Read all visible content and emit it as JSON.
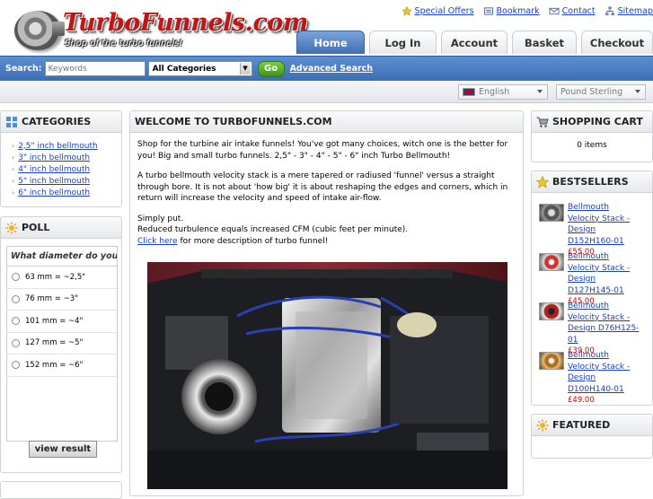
{
  "header": {
    "logo_text": "TurboFunnels.com",
    "tagline": "Shop of the turbo funnels!",
    "toplinks": [
      {
        "label": "Special Offers",
        "icon": "star-icon"
      },
      {
        "label": "Bookmark",
        "icon": "bookmark-icon"
      },
      {
        "label": "Contact",
        "icon": "envelope-icon"
      },
      {
        "label": "Sitemap",
        "icon": "sitemap-icon"
      }
    ],
    "tabs": [
      "Home",
      "Log In",
      "Account",
      "Basket",
      "Checkout"
    ]
  },
  "search": {
    "label": "Search:",
    "placeholder": "Keywords",
    "category": "All Categories",
    "go": "Go",
    "advanced": "Advanced Search"
  },
  "lang": {
    "language": "English",
    "currency": "Pound Sterling"
  },
  "categories": {
    "title": "CATEGORIES",
    "items": [
      "2,5\" inch bellmouth",
      "3\" inch bellmouth",
      "4\" inch bellmouth",
      "5\" inch bellmouth",
      "6\" inch bellmouth"
    ]
  },
  "poll": {
    "title": "POLL",
    "question": "What diameter do you need?",
    "options": [
      "63 mm = ~2,5\"",
      "76 mm = ~3\"",
      "101 mm = ~4\"",
      "127 mm = ~5\"",
      "152 mm = ~6\""
    ],
    "button": "view result"
  },
  "welcome": {
    "title": "WELCOME TO TURBOFUNNELS.COM",
    "p1": "Shop for the turbine air intake funnels! You've got many choices, witch one is the better for you! Big and small turbo funnels. 2,5\" - 3\" - 4\" - 5\" - 6\" inch Turbo Bellmouth!",
    "p2": "A turbo bellmouth velocity stack is a mere tapered or radiused 'funnel' versus a straight through bore. It is not about 'how big' it is about reshaping the edges and corners, which in return will increase the velocity and speed of intake air-flow.",
    "p3a": "Simply put.",
    "p3b": "Reduced turbulence equals increased CFM (cubic feet per minute).",
    "link": "Click here",
    "link_rest": " for more description of turbo funnel!"
  },
  "cart": {
    "title": "SHOPPING CART",
    "items": "0 items"
  },
  "bestsellers": {
    "title": "BESTSELLERS",
    "items": [
      {
        "name": "Bellmouth Velocity Stack - Design D152H160-01",
        "price": "£55.00"
      },
      {
        "name": "Bellmouth Velocity Stack - Design D127H145-01",
        "price": "£45.00"
      },
      {
        "name": "Bellmouth Velocity Stack - Design D76H125-01",
        "price": "£39.00"
      },
      {
        "name": "Bellmouth Velocity Stack - Design D100H140-01",
        "price": "£49.00"
      }
    ]
  },
  "featured": {
    "title": "FEATURED"
  },
  "colors": {
    "accent": "#3f6fb3",
    "price": "#cc0000",
    "logo": "#c41414",
    "go": "#3b9414"
  }
}
